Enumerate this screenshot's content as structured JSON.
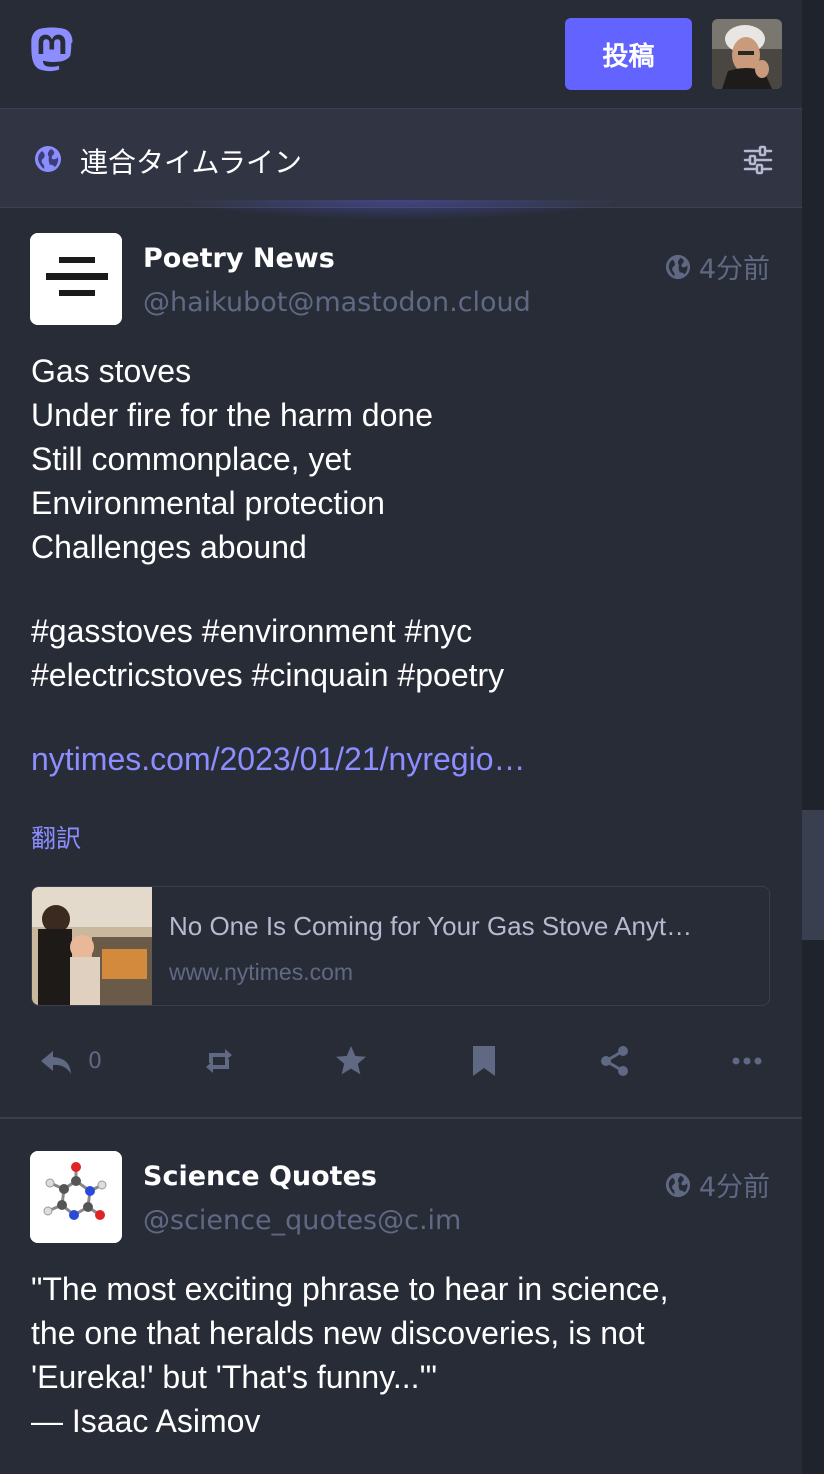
{
  "header": {
    "post_button": "投稿",
    "column_title": "連合タイムライン"
  },
  "statuses": [
    {
      "display_name": "Poetry News",
      "acct": "@haikubot@mastodon.cloud",
      "time": "4分前",
      "content_lines": [
        "Gas stoves",
        "Under fire for the harm done",
        "Still commonplace, yet",
        "Environmental protection",
        "Challenges abound"
      ],
      "hashtag_lines": [
        "#gasstoves #environment #nyc",
        "#electricstoves #cinquain #poetry"
      ],
      "link": "nytimes.com/2023/01/21/nyregio…",
      "translate": "翻訳",
      "card": {
        "title": "No One Is Coming for Your Gas Stove Anyt…",
        "host": "www.nytimes.com"
      },
      "reply_count": "0"
    },
    {
      "display_name": "Science Quotes",
      "acct": "@science_quotes@c.im",
      "time": "4分前",
      "content_lines": [
        "\"The most exciting phrase to hear in science,",
        "the one that heralds new discoveries, is not",
        "'Eureka!' but 'That's funny...'\"",
        "— Isaac Asimov"
      ]
    }
  ],
  "colors": {
    "background": "#282c37",
    "header": "#313543",
    "accent": "#6364ff",
    "link": "#8c8dff",
    "muted": "#606984"
  }
}
